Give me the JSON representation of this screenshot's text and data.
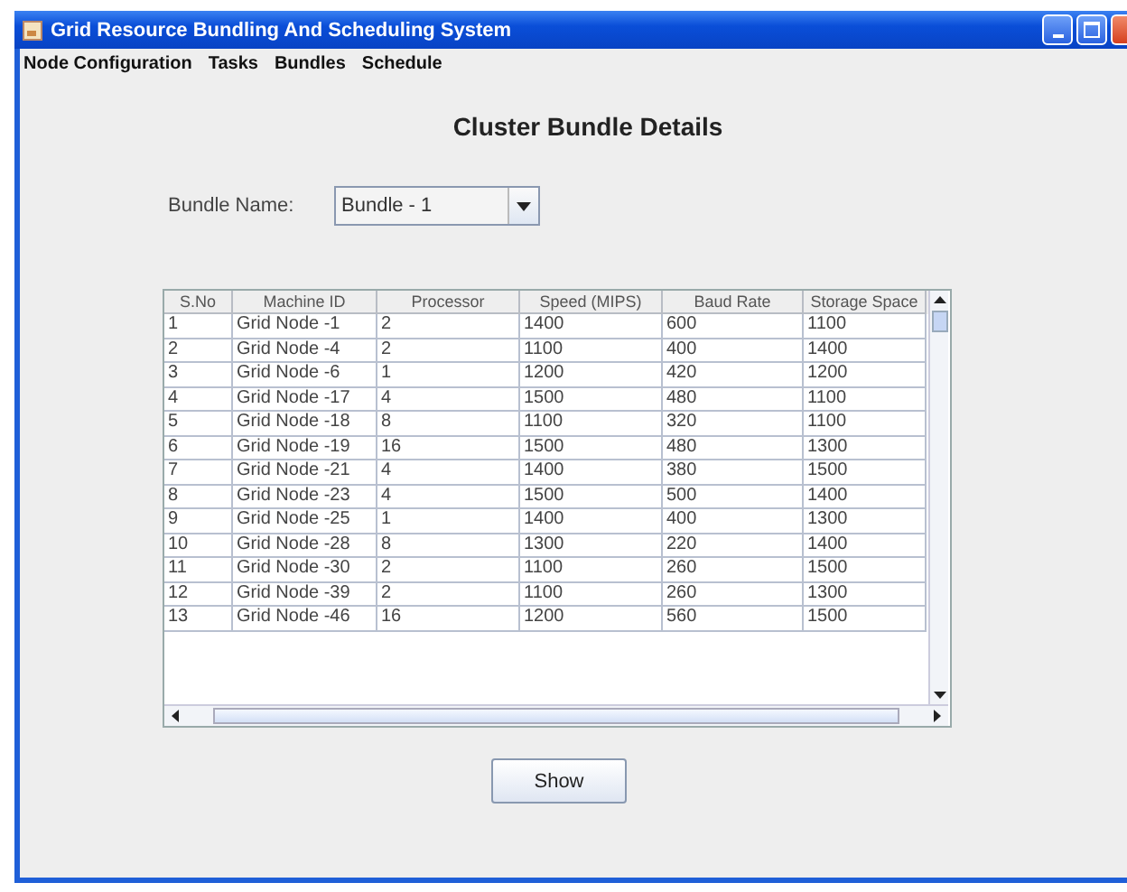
{
  "window": {
    "title": "Grid Resource Bundling And Scheduling System"
  },
  "menu": [
    "Node Configuration",
    "Tasks",
    "Bundles",
    "Schedule"
  ],
  "heading": "Cluster Bundle Details",
  "bundle": {
    "label": "Bundle Name:",
    "value": "Bundle - 1"
  },
  "table": {
    "columns": [
      "S.No",
      "Machine ID",
      "Processor",
      "Speed (MIPS)",
      "Baud Rate",
      "Storage Space"
    ],
    "rows": [
      [
        "1",
        "Grid Node -1",
        "2",
        "1400",
        "600",
        "1100"
      ],
      [
        "2",
        "Grid Node -4",
        "2",
        "1100",
        "400",
        "1400"
      ],
      [
        "3",
        "Grid Node -6",
        "1",
        "1200",
        "420",
        "1200"
      ],
      [
        "4",
        "Grid Node -17",
        "4",
        "1500",
        "480",
        "1100"
      ],
      [
        "5",
        "Grid Node -18",
        "8",
        "1100",
        "320",
        "1100"
      ],
      [
        "6",
        "Grid Node -19",
        "16",
        "1500",
        "480",
        "1300"
      ],
      [
        "7",
        "Grid Node -21",
        "4",
        "1400",
        "380",
        "1500"
      ],
      [
        "8",
        "Grid Node -23",
        "4",
        "1500",
        "500",
        "1400"
      ],
      [
        "9",
        "Grid Node -25",
        "1",
        "1400",
        "400",
        "1300"
      ],
      [
        "10",
        "Grid Node -28",
        "8",
        "1300",
        "220",
        "1400"
      ],
      [
        "11",
        "Grid Node -30",
        "2",
        "1100",
        "260",
        "1500"
      ],
      [
        "12",
        "Grid Node -39",
        "2",
        "1100",
        "260",
        "1300"
      ],
      [
        "13",
        "Grid Node -46",
        "16",
        "1200",
        "560",
        "1500"
      ]
    ]
  },
  "buttons": [
    "Show"
  ]
}
